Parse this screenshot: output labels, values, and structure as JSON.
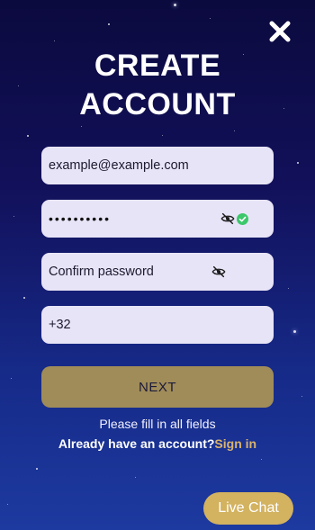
{
  "header": {
    "title_line1": "CREATE",
    "title_line2": "ACCOUNT",
    "close_icon": "close-icon"
  },
  "form": {
    "email": {
      "value": "example@example.com"
    },
    "password": {
      "value": "••••••••••",
      "toggle_icon": "eye-slash-icon",
      "valid_icon": "check-circle-icon",
      "valid_color": "#3cc76a"
    },
    "confirm_password": {
      "placeholder": "Confirm password",
      "toggle_icon": "eye-slash-icon"
    },
    "phone": {
      "value": "+32"
    }
  },
  "actions": {
    "next_label": "NEXT",
    "hint": "Please fill in all fields",
    "signin_prompt": "Already have an account?",
    "signin_link": "Sign in"
  },
  "chat": {
    "label": "Live Chat"
  },
  "colors": {
    "field_bg": "#e8e4f7",
    "next_bg": "#a08c59",
    "link": "#d9b26d",
    "chat_bg": "#d3b260"
  }
}
